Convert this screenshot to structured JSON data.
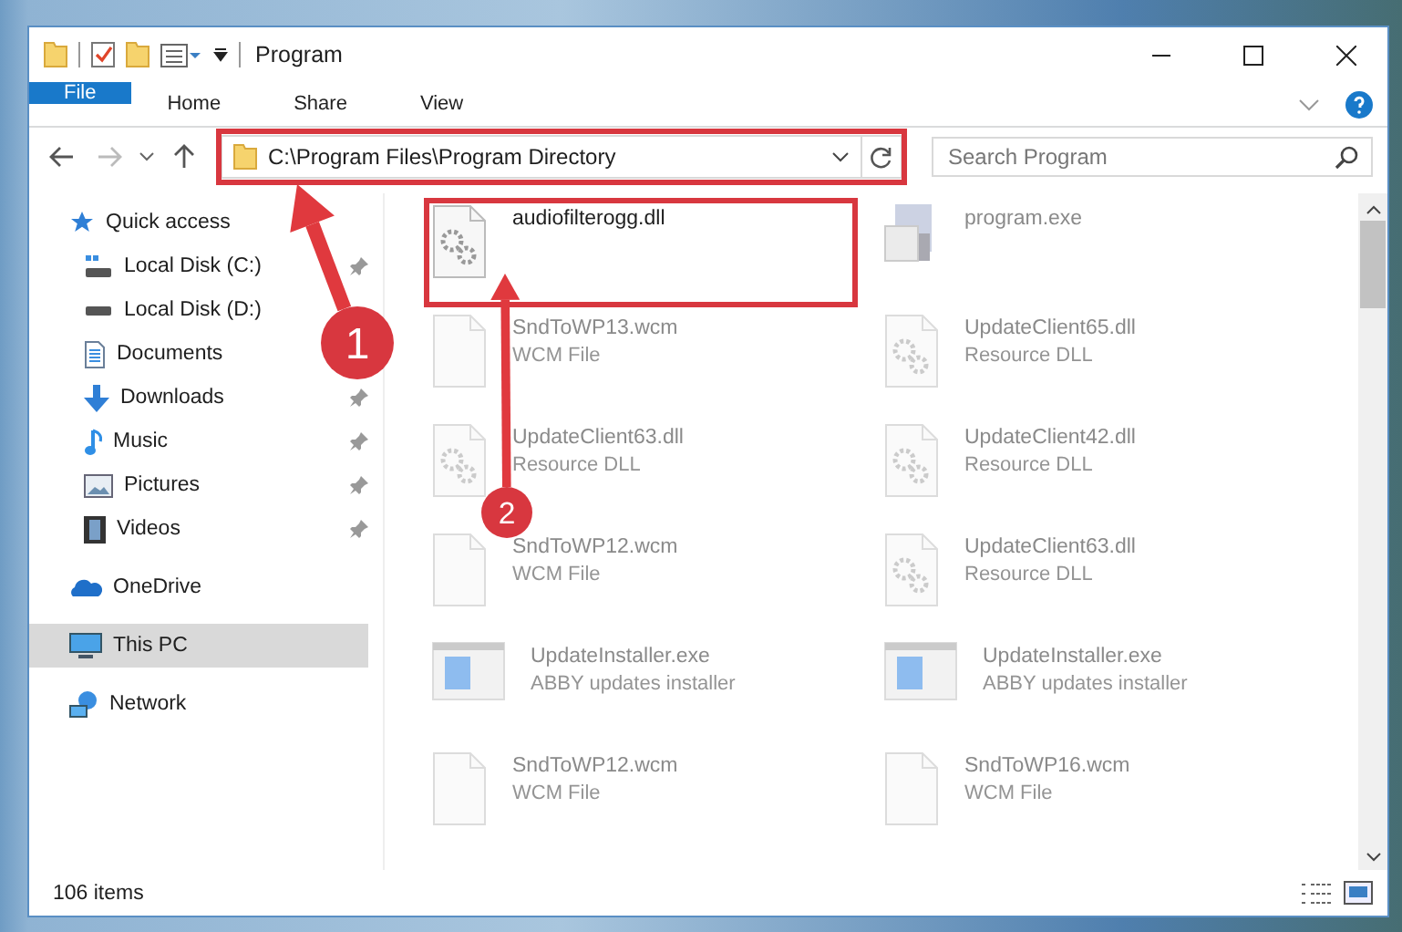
{
  "window": {
    "title": "Program"
  },
  "ribbon_tabs": [
    {
      "label": "File",
      "kind": "file"
    },
    {
      "label": "Home",
      "kind": "tab"
    },
    {
      "label": "Share",
      "kind": "tab"
    },
    {
      "label": "View",
      "kind": "tab"
    }
  ],
  "address_bar": {
    "path": "C:\\Program Files\\Program Directory"
  },
  "search": {
    "placeholder": "Search Program"
  },
  "sidebar": {
    "items": [
      {
        "label": "Quick access",
        "kind": "star",
        "selected": false,
        "children": [
          {
            "label": "Local Disk (C:)",
            "kind": "drive_c",
            "pinned": true
          },
          {
            "label": "Local Disk (D:)",
            "kind": "drive",
            "pinned": false
          },
          {
            "label": "Documents",
            "kind": "documents",
            "pinned": false
          },
          {
            "label": "Downloads",
            "kind": "downloads",
            "pinned": true
          },
          {
            "label": "Music",
            "kind": "music",
            "pinned": true
          },
          {
            "label": "Pictures",
            "kind": "pictures",
            "pinned": true
          },
          {
            "label": "Videos",
            "kind": "videos",
            "pinned": true
          }
        ]
      },
      {
        "label": "OneDrive",
        "kind": "cloud",
        "selected": false
      },
      {
        "label": "This PC",
        "kind": "pc",
        "selected": true
      },
      {
        "label": "Network",
        "kind": "network",
        "selected": false
      }
    ]
  },
  "files": [
    {
      "name": "audiofilterogg.dll",
      "kind": "dll",
      "faded": false
    },
    {
      "name": "program.exe",
      "kind": "program",
      "faded": true
    },
    {
      "name": "SndToWP13.wcm",
      "type": "WCM File",
      "kind": "blank",
      "faded": true
    },
    {
      "name": "UpdateClient65.dll",
      "type": "Resource DLL",
      "kind": "dll",
      "faded": true
    },
    {
      "name": "UpdateClient63.dll",
      "type": "Resource DLL",
      "kind": "dll",
      "faded": true
    },
    {
      "name": "UpdateClient42.dll",
      "type": "Resource DLL",
      "kind": "dll",
      "faded": true
    },
    {
      "name": "SndToWP12.wcm",
      "type": "WCM File",
      "kind": "blank",
      "faded": true
    },
    {
      "name": "UpdateClient63.dll",
      "type": "Resource DLL",
      "kind": "dll",
      "faded": true
    },
    {
      "name": "UpdateInstaller.exe",
      "type": "ABBY updates installer",
      "kind": "installer",
      "faded": true
    },
    {
      "name": "UpdateInstaller.exe",
      "type": "ABBY updates installer",
      "kind": "installer",
      "faded": true
    },
    {
      "name": "SndToWP12.wcm",
      "type": "WCM File",
      "kind": "blank",
      "faded": true
    },
    {
      "name": "SndToWP16.wcm",
      "type": "WCM File",
      "kind": "blank",
      "faded": true
    }
  ],
  "status_bar": {
    "item_count": "106 items"
  },
  "annotations": [
    {
      "label": "1"
    },
    {
      "label": "2"
    }
  ]
}
